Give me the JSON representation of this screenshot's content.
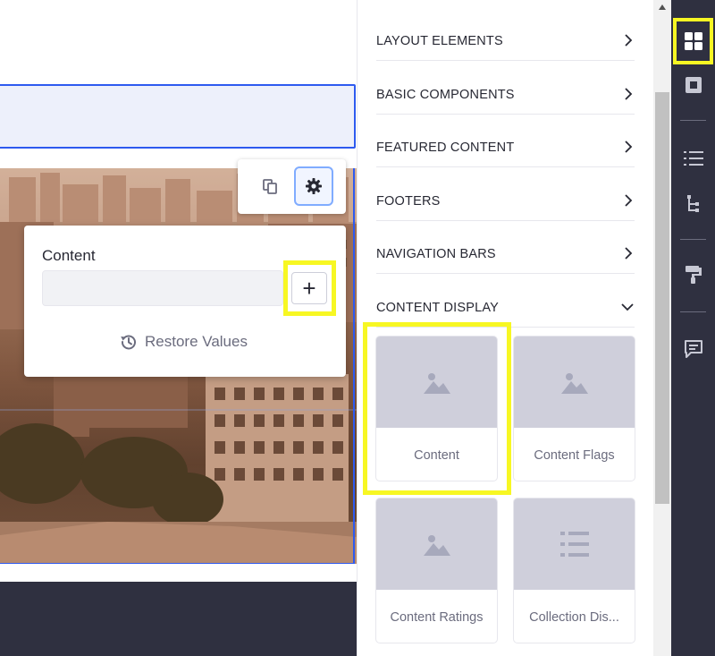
{
  "canvas": {
    "popover": {
      "content_label": "Content",
      "input_value": "",
      "add_button_symbol": "+",
      "restore_label": "Restore Values"
    },
    "toolbar": {
      "duplicate_icon": "duplicate-icon",
      "settings_icon": "gear-icon"
    }
  },
  "sidebar": {
    "categories": [
      {
        "label": "LAYOUT ELEMENTS",
        "state": "collapsed"
      },
      {
        "label": "BASIC COMPONENTS",
        "state": "collapsed"
      },
      {
        "label": "FEATURED CONTENT",
        "state": "collapsed"
      },
      {
        "label": "FOOTERS",
        "state": "collapsed"
      },
      {
        "label": "NAVIGATION BARS",
        "state": "collapsed"
      },
      {
        "label": "CONTENT DISPLAY",
        "state": "expanded"
      }
    ],
    "fragments": [
      {
        "label": "Content",
        "icon": "image-icon"
      },
      {
        "label": "Content Flags",
        "icon": "image-icon"
      },
      {
        "label": "Content Ratings",
        "icon": "image-icon"
      },
      {
        "label": "Collection Dis...",
        "icon": "list-icon"
      }
    ]
  },
  "icon_bar": {
    "items": [
      "fragments-icon",
      "widgets-icon",
      "page-structure-icon",
      "hierarchy-icon",
      "style-book-icon",
      "comments-icon"
    ]
  },
  "colors": {
    "highlight": "#f7f723",
    "accent": "#2e5aef",
    "icon_bar_bg": "#2f3040",
    "thumb_bg": "#cfcfdb"
  }
}
